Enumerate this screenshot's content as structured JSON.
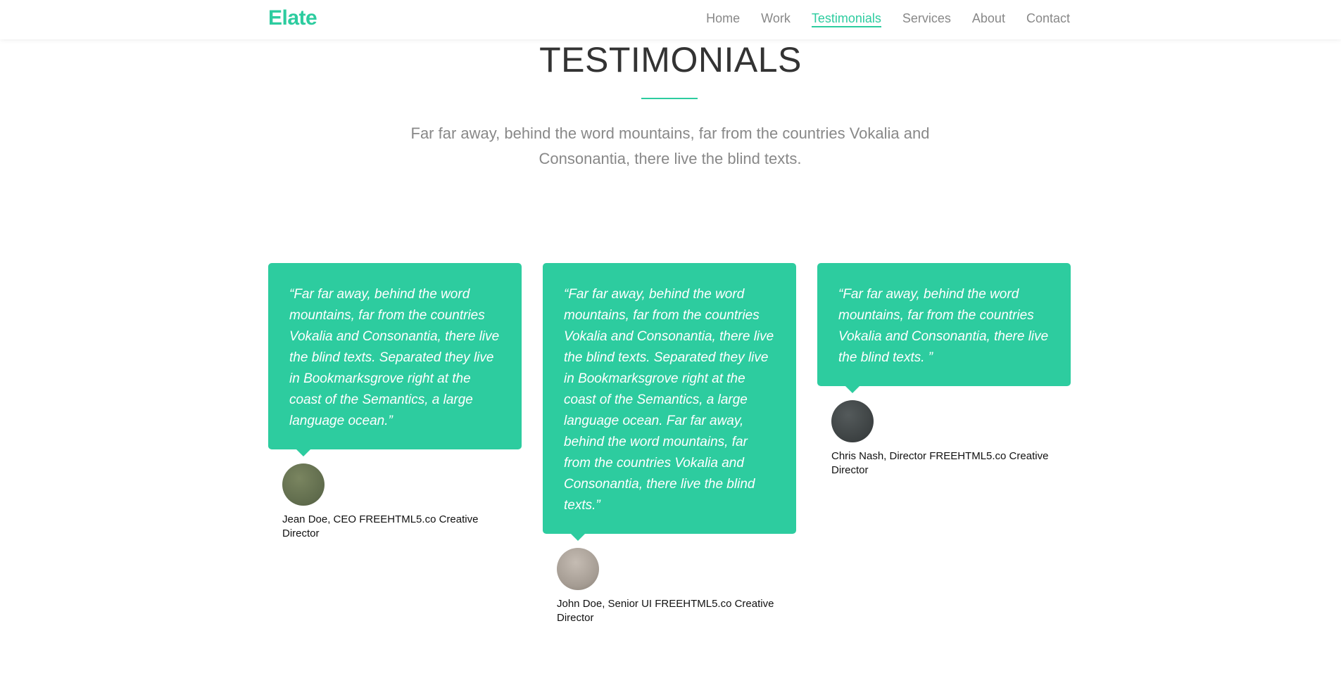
{
  "header": {
    "brand": "Elate",
    "nav": [
      {
        "label": "Home"
      },
      {
        "label": "Work"
      },
      {
        "label": "Testimonials"
      },
      {
        "label": "Services"
      },
      {
        "label": "About"
      },
      {
        "label": "Contact"
      }
    ],
    "active_item": "Testimonials"
  },
  "section": {
    "title": "TESTIMONIALS",
    "subtitle": "Far far away, behind the word mountains, far from the countries Vokalia and Consonantia, there live the blind texts."
  },
  "testimonials": [
    {
      "quote": "“Far far away, behind the word mountains, far from the countries Vokalia and Consonantia, there live the blind texts. Separated they live in Bookmarksgrove right at the coast of the Semantics, a large language ocean.”",
      "author": "Jean Doe, CEO FREEHTML5.co Creative Director",
      "avatar_color": "#5f6b4c"
    },
    {
      "quote": "“Far far away, behind the word mountains, far from the countries Vokalia and Consonantia, there live the blind texts. Separated they live in Bookmarksgrove right at the coast of the Semantics, a large language ocean. Far far away, behind the word mountains, far from the countries Vokalia and Consonantia, there live the blind texts.”",
      "author": "John Doe, Senior UI FREEHTML5.co Creative Director",
      "avatar_color": "#a59c93"
    },
    {
      "quote": "“Far far away, behind the word mountains, far from the countries Vokalia and Consonantia, there live the blind texts. ”",
      "author": "Chris Nash, Director FREEHTML5.co Creative Director",
      "avatar_color": "#3c4142"
    }
  ],
  "colors": {
    "accent": "#2dcc9f",
    "muted_text": "#888888"
  }
}
